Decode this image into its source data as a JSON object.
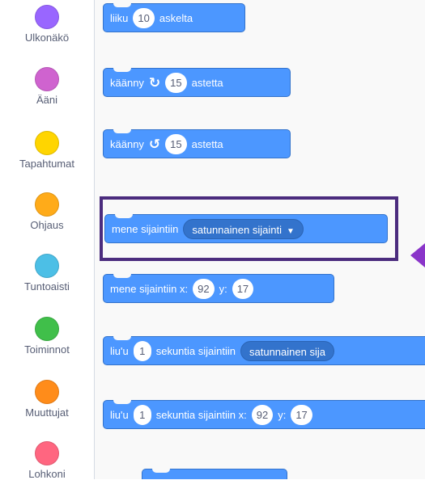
{
  "sidebar": {
    "categories": [
      {
        "label": "Ulkonäkö",
        "color": "#9966ff"
      },
      {
        "label": "Ääni",
        "color": "#cf63cf"
      },
      {
        "label": "Tapahtumat",
        "color": "#ffd500"
      },
      {
        "label": "Ohjaus",
        "color": "#ffab19"
      },
      {
        "label": "Tuntoaisti",
        "color": "#4cbfe6"
      },
      {
        "label": "Toiminnot",
        "color": "#40bf4a"
      },
      {
        "label": "Muuttujat",
        "color": "#ff8c1a"
      },
      {
        "label": "Lohkoni",
        "color": "#ff6680"
      }
    ]
  },
  "blocks": {
    "move": {
      "pre": "liiku",
      "value": "10",
      "post": "askelta"
    },
    "turn_right": {
      "pre": "käänny",
      "icon": "rotate-clockwise-icon",
      "value": "15",
      "post": "astetta"
    },
    "turn_left": {
      "pre": "käänny",
      "icon": "rotate-counterclockwise-icon",
      "value": "15",
      "post": "astetta"
    },
    "goto_random": {
      "pre": "mene sijaintiin",
      "option": "satunnainen sijainti"
    },
    "goto_xy": {
      "pre": "mene sijaintiin x:",
      "x": "92",
      "ylabel": "y:",
      "y": "17"
    },
    "glide_random": {
      "pre": "liu'u",
      "value": "1",
      "mid": "sekuntia sijaintiin",
      "option": "satunnainen sija"
    },
    "glide_xy": {
      "pre": "liu'u",
      "value": "1",
      "mid": "sekuntia sijaintiin x:",
      "x": "92",
      "ylabel": "y:",
      "y": "17"
    }
  },
  "colors": {
    "motion_block": "#4c97ff",
    "highlight_border": "#4b2c7e",
    "pointer_arrow": "#8a35c9"
  }
}
